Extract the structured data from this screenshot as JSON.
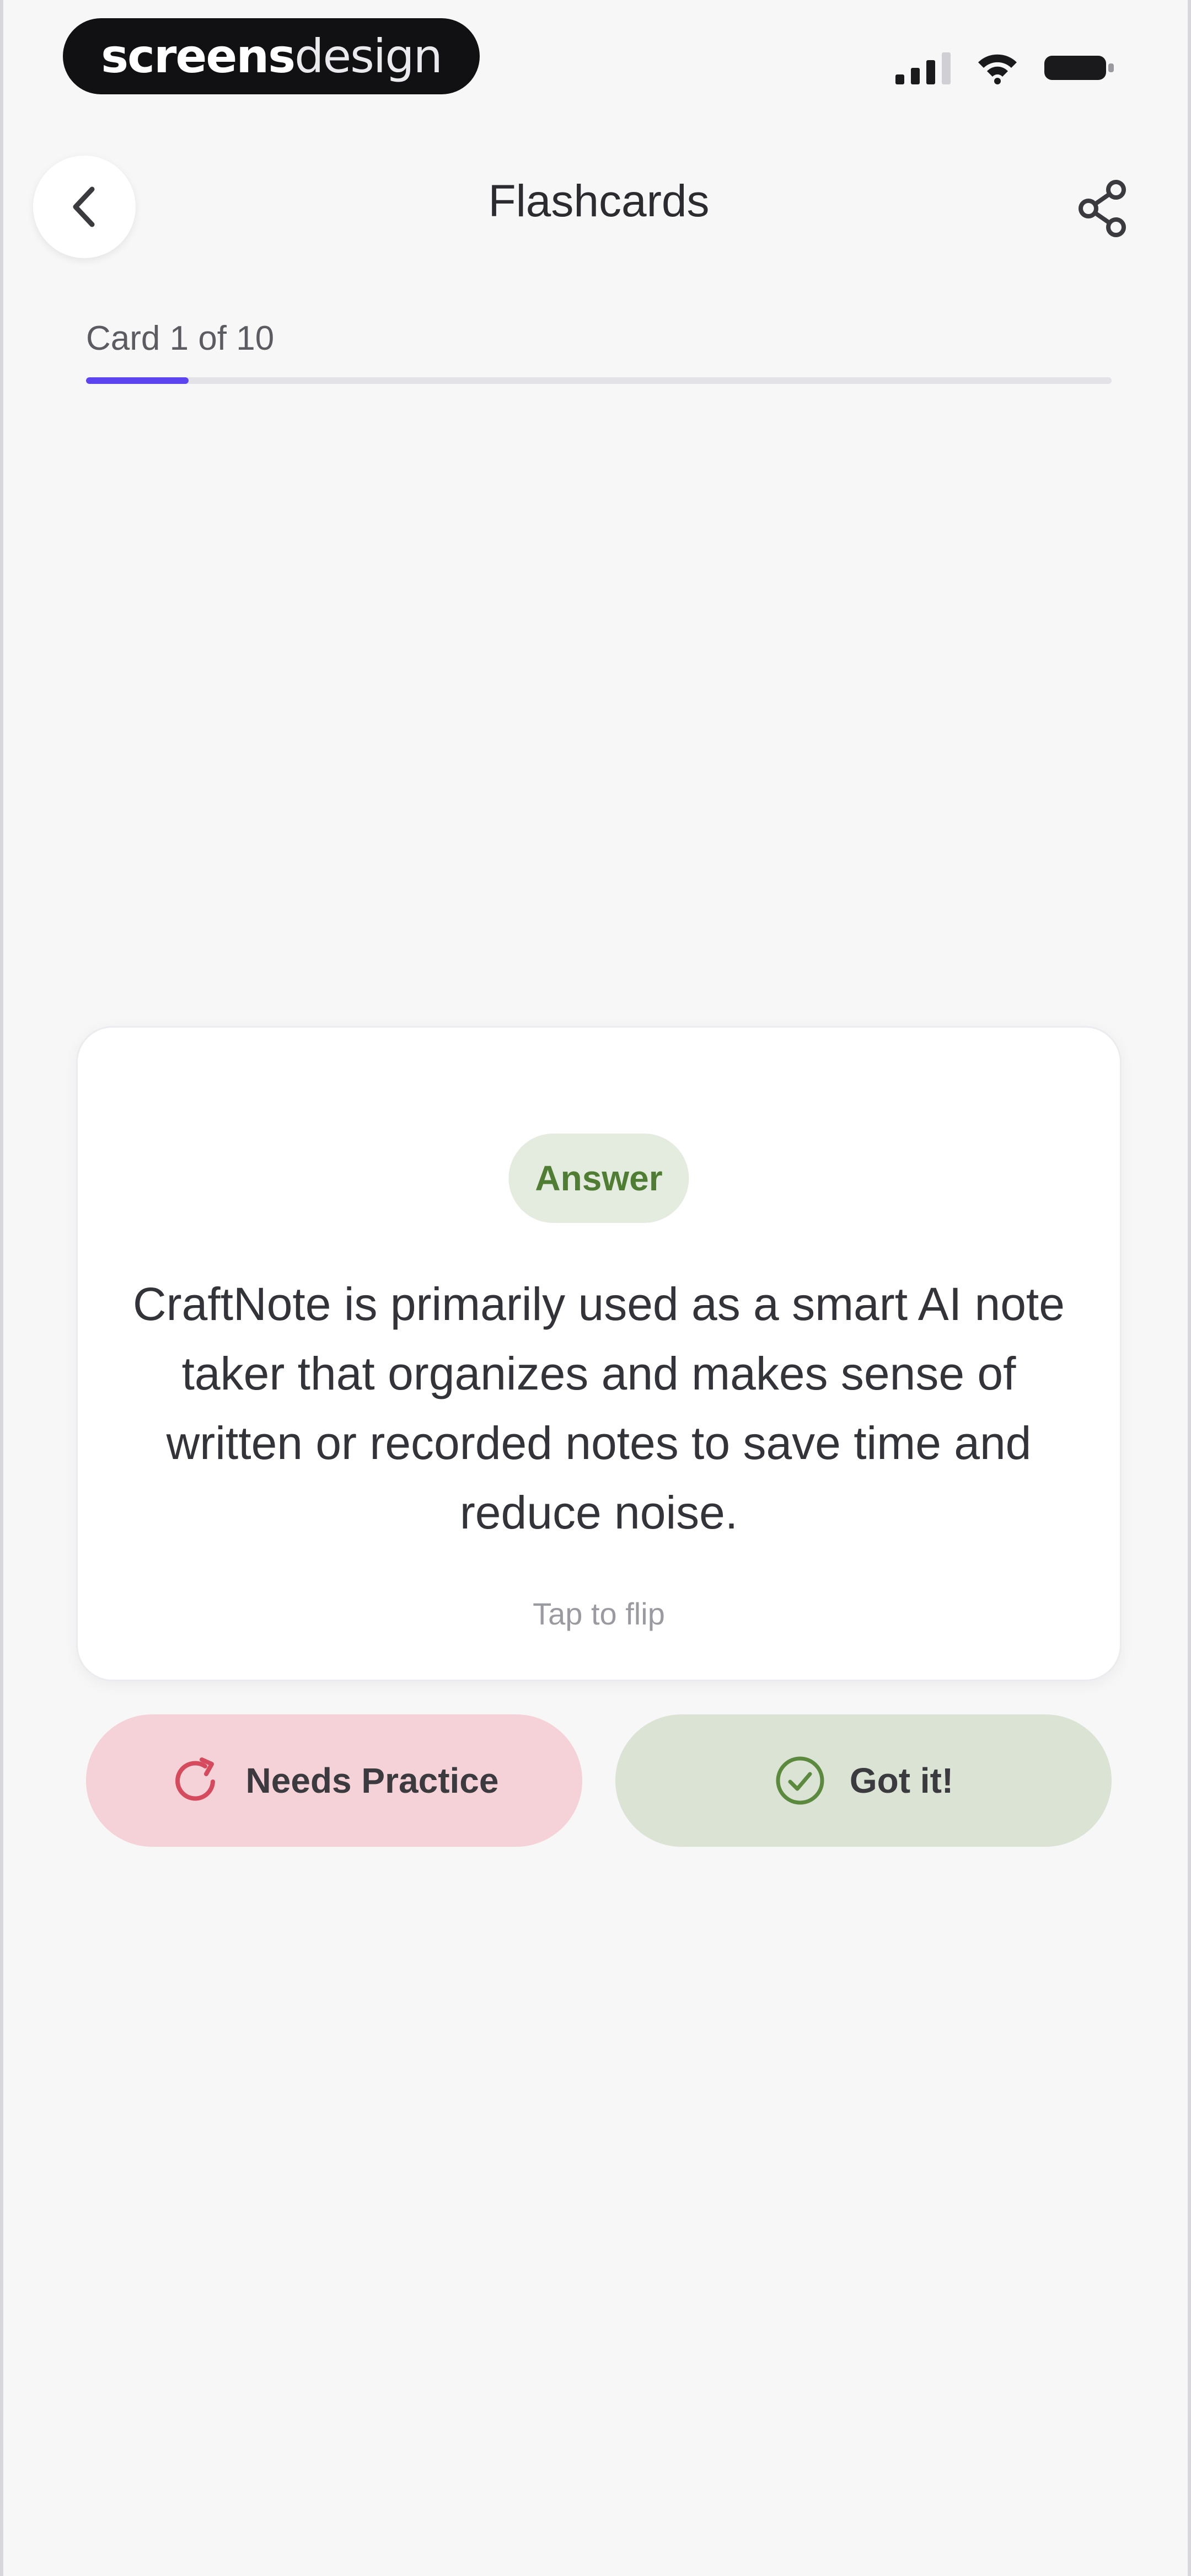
{
  "watermark": {
    "part1": "screens",
    "part2": "design"
  },
  "status_bar": {
    "icons": [
      "cellular-signal-icon",
      "wifi-icon",
      "battery-icon"
    ]
  },
  "header": {
    "title": "Flashcards",
    "back_icon": "chevron-left-icon",
    "share_icon": "share-icon"
  },
  "progress": {
    "label": "Card 1 of 10",
    "current": 1,
    "total": 10,
    "fraction": 0.1,
    "color": "#5c45f0"
  },
  "card": {
    "badge": "Answer",
    "text": "CraftNote is primarily used as a smart AI note taker that organizes and makes sense of written or recorded notes to save time and reduce noise.",
    "hint": "Tap to flip"
  },
  "actions": {
    "needs_practice": {
      "label": "Needs Practice",
      "icon": "refresh-icon",
      "color": "#d64a5e",
      "background": "#f4d2d7"
    },
    "got_it": {
      "label": "Got it!",
      "icon": "check-circle-icon",
      "color": "#5b8a3e",
      "background": "#dbe3d4"
    }
  }
}
